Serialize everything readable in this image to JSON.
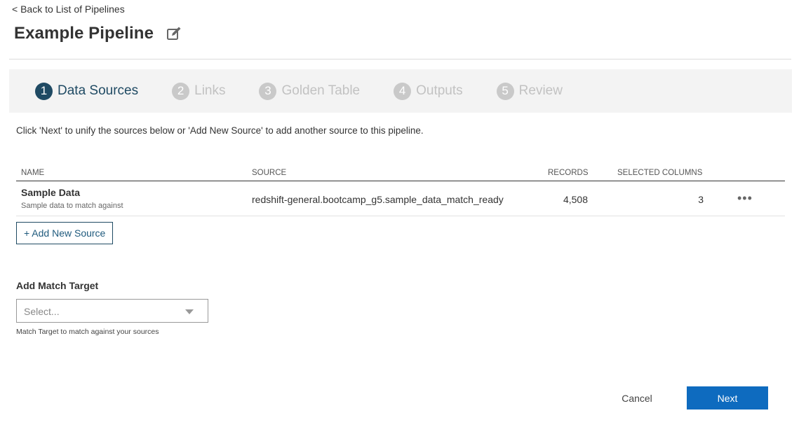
{
  "nav": {
    "back_label": "< Back to List of Pipelines"
  },
  "header": {
    "title": "Example Pipeline"
  },
  "steps": [
    {
      "number": "1",
      "label": "Data Sources",
      "active": true
    },
    {
      "number": "2",
      "label": "Links",
      "active": false
    },
    {
      "number": "3",
      "label": "Golden Table",
      "active": false
    },
    {
      "number": "4",
      "label": "Outputs",
      "active": false
    },
    {
      "number": "5",
      "label": "Review",
      "active": false
    }
  ],
  "instructions": "Click 'Next' to unify the sources below or 'Add New Source' to add another source to this pipeline.",
  "table": {
    "columns": [
      "NAME",
      "SOURCE",
      "RECORDS",
      "SELECTED COLUMNS"
    ],
    "rows": [
      {
        "name": "Sample Data",
        "description": "Sample data to match against",
        "source": "redshift-general.bootcamp_g5.sample_data_match_ready",
        "records": "4,508",
        "selected_columns": "3",
        "more_label": "•••"
      }
    ]
  },
  "add_source_label": "+ Add New Source",
  "match_target": {
    "label": "Add Match Target",
    "placeholder": "Select...",
    "helper": "Match Target to match against your sources"
  },
  "footer": {
    "cancel_label": "Cancel",
    "next_label": "Next"
  },
  "colors": {
    "active_step": "#1f4a63",
    "inactive_step": "#c9c9c9",
    "primary_button": "#0e6bbf"
  }
}
